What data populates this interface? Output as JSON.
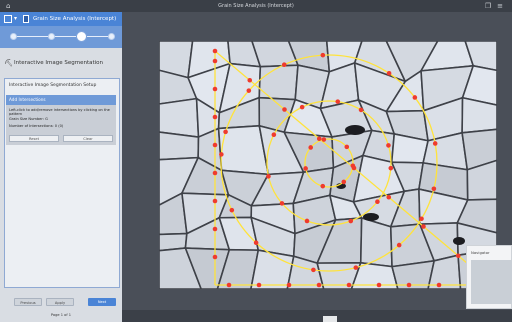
{
  "window": {
    "title": "Grain Size Analysis (Intercept)"
  },
  "panel": {
    "header_title": "Grain Size Analysis (Intercept)",
    "section_title": "Interactive Image Segmentation",
    "card_title": "Interactive Image Segmentation Setup",
    "selected_item": "Add Intersections",
    "help_lines": [
      "Left-click to add/remove intersections by clicking on the pattern",
      "Grain Size Number: G",
      "Number of Intersections: 0 (0)"
    ],
    "reset_label": "Reset",
    "clear_label": "Clear",
    "previous_label": "Previous",
    "apply_label": "Apply",
    "next_label": "Next",
    "page_label": "Page 1 of 1"
  },
  "navigator": {
    "label": "Navigator"
  },
  "colors": {
    "accent": "#4a84d6",
    "overlay": "#ffeb3b",
    "intersection": "#ef3b2d"
  },
  "overlay": {
    "pattern": "concentric-circles-and-lines"
  }
}
